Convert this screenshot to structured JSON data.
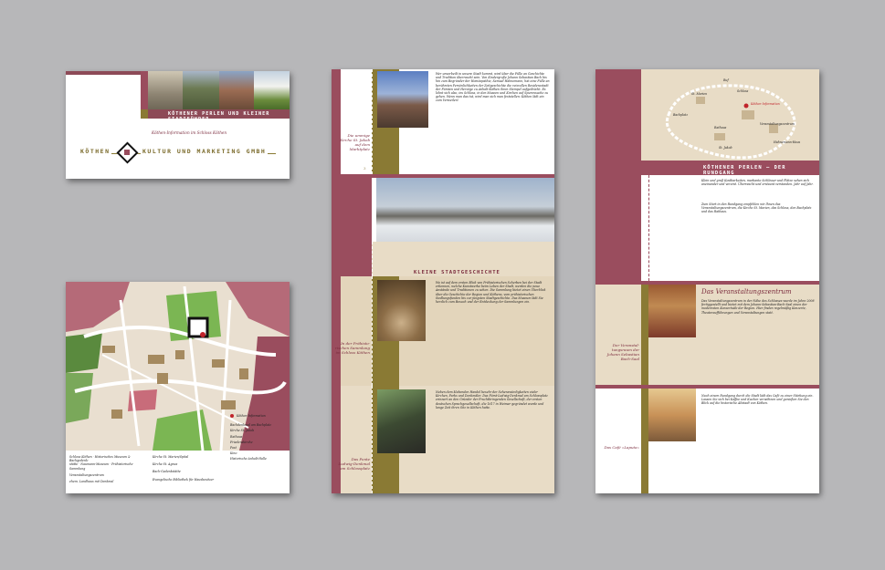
{
  "card": {
    "band_title": "KÖTHENER PERLEN UND KLEINER STADTFÜHRER",
    "subtitle": "Köthen-Information im Schloss Köthen",
    "logo_left": "KÖTHEN",
    "logo_right": "KULTUR UND MARKETING GMBH"
  },
  "map_legend": {
    "col1": [
      "Schloss Köthen · Historisches Museum & Bachgedenk-",
      "stätte · Naumann-Museum · Prähistorische Sammlung",
      "Veranstaltungszentrum",
      "ehem. Landhaus mit Denkmal"
    ],
    "col2": [
      "Kirche St. Marien/Spital",
      "Kirche St. Agnus",
      "Bach-Gedenkstätte",
      "Evangelische Bibliothek für Hausbesitzer"
    ],
    "col3": [
      "Bachdenkmal am Bachplatz",
      "Kirche St. Jakob",
      "Rathaus",
      "Friedenskirche",
      "Post",
      "Kino",
      "Historische Anhalt-Halle"
    ],
    "marker_label": "Köthen-Information"
  },
  "middle": {
    "section_title": "KLEINE STADTGESCHICHTE",
    "caption1": "Die ummige Kirche St. Jakob auf dem Marktplatz",
    "caption2": "In der Prähisto-rischen Sammlung im Schloss Köthen",
    "caption3": "Das Ponte Ludwig-Denkmal am Schlossplatz",
    "page_num": "3",
    "text1": "Wer unvorbeilt in unsere Stadt kommt, wird über die Fülle an Geschichte und Tradition überrascht sein. Von Kindergroße Johann Sebastian Bach bis hin zum Begründer der Homöopathie, Samuel Hahnemann, hat eine Fülle an berühmten Persönlichkeiten der Zeitgeschichte die reizvollen Residenzstadt der Fürsten und Herzöge zu Anhalt-Köthen ihren Stempel aufgedrückt. Es lohnt sich also, ins Schloss, in den Museen und Kirchen auf Spurensuche zu gehen. Wenn man das tut, wird man sich man feststellen: Köthen lädt ein zum Verweilen!",
    "text2": "Wo ist auf dem ersten Blick von Prähistorischen Scherben bei der Stadt erkennen, welche Kunstwerke beim Leben der Stadt, werden die neue Anstände und Traditionen zu sehen. Die Sammlung bietet einen Überblick über die Geschichte der Region und Köthens, vom prähistorischen Siedlungsfunden bis zur jüngsten Stadtgeschichte. Das Museum lädt Sie herzlich zum Besuch und der Entdeckung der Sammlungen ein.",
    "text3": "Neben dem klebenden Handel besehr der Sehenswürdigkeiten vieler Kirchen, Parks und Denkmäler. Das Fürst-Ludwig-Denkmal am Schlossplatz erinnert an den Gründer der Fruchtbringenden Gesellschaft, der ersten deutschen Sprachgesellschaft, die 1617 in Weimar gegründet wurde und lange Zeit ihren Sitz in Köthen hatte."
  },
  "right": {
    "header": "KÖTHENER PERLEN — DER RUNDGANG",
    "section1": "Das Veranstaltungszentrum",
    "caption1": "Der Veranstal-tungsraum der Johann Sebastian Bach-Saal",
    "caption2": "Das Café »Laputa«",
    "text1": "Klein und groß Kostbarkeiten, markante Schlösser und Plätze sehen sich aneinander und vereint. Überrascht und erstaunt verstanden. Jahr auf Jahr.",
    "text2": "Zum Start in den Rundgang empfehlen wir Ihnen das Veranstaltungszentrum, die Kirche St. Marien, das Schloss, den Bachplatz und das Rathaus.",
    "text3": "Das Veranstaltungszentrum in der Nähe des Schlosses wurde im Jahre 2008 fertiggestellt und bietet mit dem Johann-Sebastian-Bach-Saal einen der modernsten Konzertsäle der Region. Hier finden regelmäßig Konzerte, Theateraufführungen und Veranstaltungen statt.",
    "text4": "Nach einem Rundgang durch die Stadt lädt das Café zu einer Stärkung ein. Lassen Sie sich bei Kaffee und Kuchen verwöhnen und genießen Sie den Blick auf die historische Altstadt von Köthen.",
    "map_labels": [
      "St. Marien",
      "Ruf",
      "Schloss",
      "Köthen-Information",
      "Bachplatz",
      "Veranstaltungszentrum",
      "Rathaus",
      "St. Jakob",
      "Hahnemann-Haus"
    ]
  }
}
